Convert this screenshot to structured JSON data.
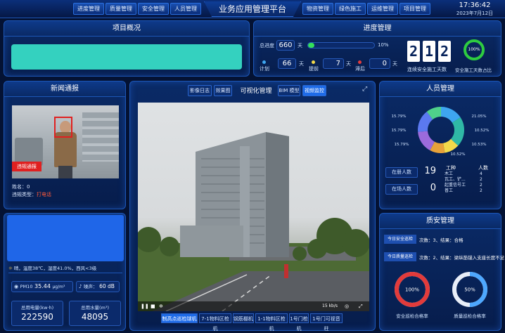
{
  "header": {
    "title": "业务应用管理平台",
    "time": "17:36:42",
    "date": "2023年7月12日",
    "nav_left": [
      "进度管理",
      "质量管理",
      "安全管理",
      "人员管理"
    ],
    "nav_right": [
      "物资管理",
      "绿色施工",
      "运维管理",
      "项目管理"
    ]
  },
  "overview": {
    "title": "项目概况"
  },
  "progress": {
    "title": "进度管理",
    "total_label": "总进度",
    "total_value": "660",
    "unit": "天",
    "percent_label": "10%",
    "percent": 10,
    "plan_label": "计划",
    "plan_value": "66",
    "ahead_label": "提前",
    "ahead_value": "7",
    "delay_label": "滞后",
    "delay_value": "0",
    "safe_days": [
      "2",
      "1",
      "2"
    ],
    "safe_days_label": "连续安全施工天数",
    "ratio_value": "100%",
    "ratio_label": "安全施工天数占比"
  },
  "news": {
    "title": "新闻通报",
    "tag": "违规通报",
    "name_label": "姓名：",
    "name_value": "0",
    "type_label": "违规类型：",
    "type_value": "打电话"
  },
  "env": {
    "weather": "晴，温度38℃，湿度41.0%，西风<3级",
    "pm_label": "PM10",
    "pm_value": "35.44",
    "pm_unit": "μg/m³",
    "noise_label": "噪声：",
    "noise_value": "60 dB",
    "power_label": "总用电量(kw·h)",
    "power_value": "222590",
    "water_label": "总用水量(m³)",
    "water_value": "48095"
  },
  "visual": {
    "title": "可视化管理",
    "left_tabs": [
      "影像日志",
      "效果图"
    ],
    "right_tabs": [
      "BIM 模型",
      "视频监控"
    ],
    "speed": "15 kb/s",
    "cameras": [
      "制高点巡检球机",
      "7-1物料区枪机",
      "钢筋棚机",
      "1-1物料区枪机",
      "1号门枪机",
      "1号门可视音柱"
    ]
  },
  "people": {
    "title": "人员管理",
    "donut_labels": [
      "15.79%",
      "21.05%",
      "10.52%",
      "10.53%",
      "15.79%",
      "15.79%",
      "10.52%"
    ],
    "registered_label": "在册人数",
    "registered_value": "19",
    "onsite_label": "在场人数",
    "onsite_value": "0",
    "col_type": "工种",
    "col_count": "人数",
    "rows": [
      {
        "type": "木工",
        "count": "4"
      },
      {
        "type": "瓦工、铲...",
        "count": "2"
      },
      {
        "type": "起重信号工",
        "count": "2"
      },
      {
        "type": "普工",
        "count": "2"
      }
    ]
  },
  "qs": {
    "title": "质安管理",
    "safety_tag": "今日安全巡检",
    "safety_text": "次数：3、结果：合格",
    "quality_tag": "今日质量巡检",
    "quality_text": "次数：2、结果：梁纵筋锚入支座长度不足",
    "safety_rate": "100%",
    "safety_rate_value": 100,
    "safety_rate_label": "安全巡检合格率",
    "quality_rate": "50%",
    "quality_rate_value": 50,
    "quality_rate_label": "质量巡检合格率"
  },
  "colors": {
    "accent": "#1e6be8",
    "donut": [
      "#3ea6f0",
      "#2fb8a6",
      "#f2d94a",
      "#e8a23a",
      "#9b6bdc",
      "#5b79f0",
      "#4fd08a"
    ],
    "safety_ring": "#e23b3b",
    "quality_ring": "#4ea8ff",
    "ratio_ring": "#2ecc40"
  }
}
